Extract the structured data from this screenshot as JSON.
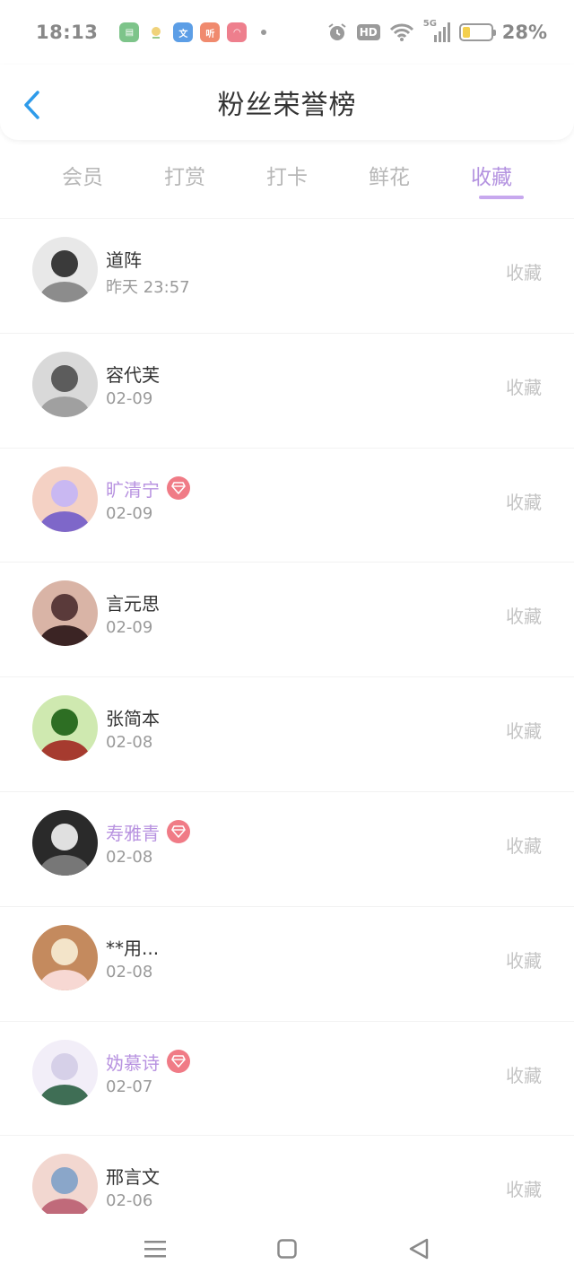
{
  "status_bar": {
    "time": "18:13",
    "battery_text": "28%",
    "battery_level": 0.28,
    "network_label": "5G",
    "hd_label": "HD",
    "icons": [
      "app-green-icon",
      "app-weather-icon",
      "app-blue-icon",
      "app-listen-icon",
      "app-pink-icon",
      "alarm-icon",
      "wifi-icon",
      "signal-icon",
      "battery-icon"
    ]
  },
  "header": {
    "title": "粉丝荣誉榜"
  },
  "tabs": [
    {
      "label": "会员",
      "active": false
    },
    {
      "label": "打赏",
      "active": false
    },
    {
      "label": "打卡",
      "active": false
    },
    {
      "label": "鲜花",
      "active": false
    },
    {
      "label": "收藏",
      "active": true
    }
  ],
  "list": [
    {
      "name": "道阵",
      "date": "昨天 23:57",
      "action": "收藏",
      "vip": false
    },
    {
      "name": "容代芙",
      "date": "02-09",
      "action": "收藏",
      "vip": false
    },
    {
      "name": "旷清宁",
      "date": "02-09",
      "action": "收藏",
      "vip": true
    },
    {
      "name": "言元思",
      "date": "02-09",
      "action": "收藏",
      "vip": false
    },
    {
      "name": "张简本",
      "date": "02-08",
      "action": "收藏",
      "vip": false
    },
    {
      "name": "寿雅青",
      "date": "02-08",
      "action": "收藏",
      "vip": true
    },
    {
      "name": "**用...",
      "date": "02-08",
      "action": "收藏",
      "vip": false
    },
    {
      "name": "妫慕诗",
      "date": "02-07",
      "action": "收藏",
      "vip": true
    },
    {
      "name": "邢言文",
      "date": "02-06",
      "action": "收藏",
      "vip": false
    }
  ],
  "colors": {
    "accent": "#b493e0",
    "vip_badge": "#f07b86",
    "back_arrow": "#2e9bea",
    "muted_text": "#c4c4c4"
  },
  "nav_bar": {
    "icons": [
      "menu-icon",
      "home-icon",
      "back-triangle-icon"
    ]
  }
}
